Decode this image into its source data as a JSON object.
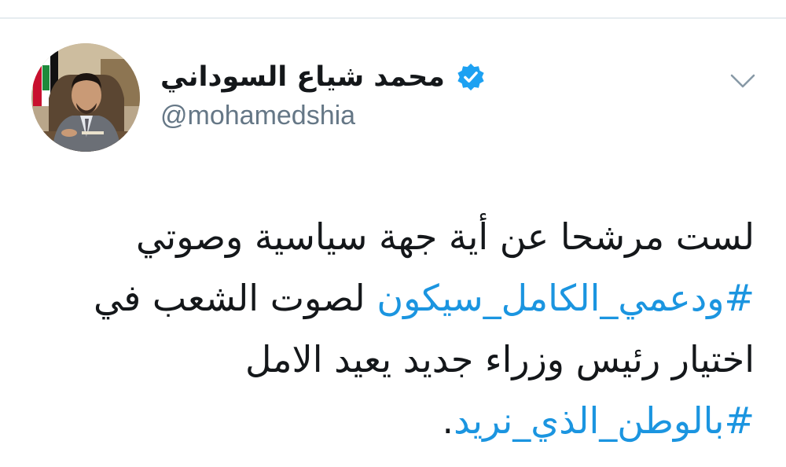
{
  "author": {
    "display_name": "محمد شياع السوداني",
    "handle": "@mohamedshia",
    "verified": true
  },
  "icons": {
    "verified": "verified-badge-icon",
    "menu": "chevron-down-icon"
  },
  "tweet": {
    "line1": "لست مرشحا عن أية جهة سياسية وصوتي",
    "line2_hashtag": "#ودعمي_الكامل_سيكون",
    "line2_text": " لصوت الشعب في",
    "line3": "اختيار  رئيس وزراء جديد يعيد الامل",
    "line4_hashtag": "#بالوطن_الذي_نريد",
    "line4_punct": "."
  },
  "colors": {
    "link": "#1b95e0",
    "verified": "#1da1f2",
    "text": "#14171a",
    "secondary": "#657786"
  }
}
